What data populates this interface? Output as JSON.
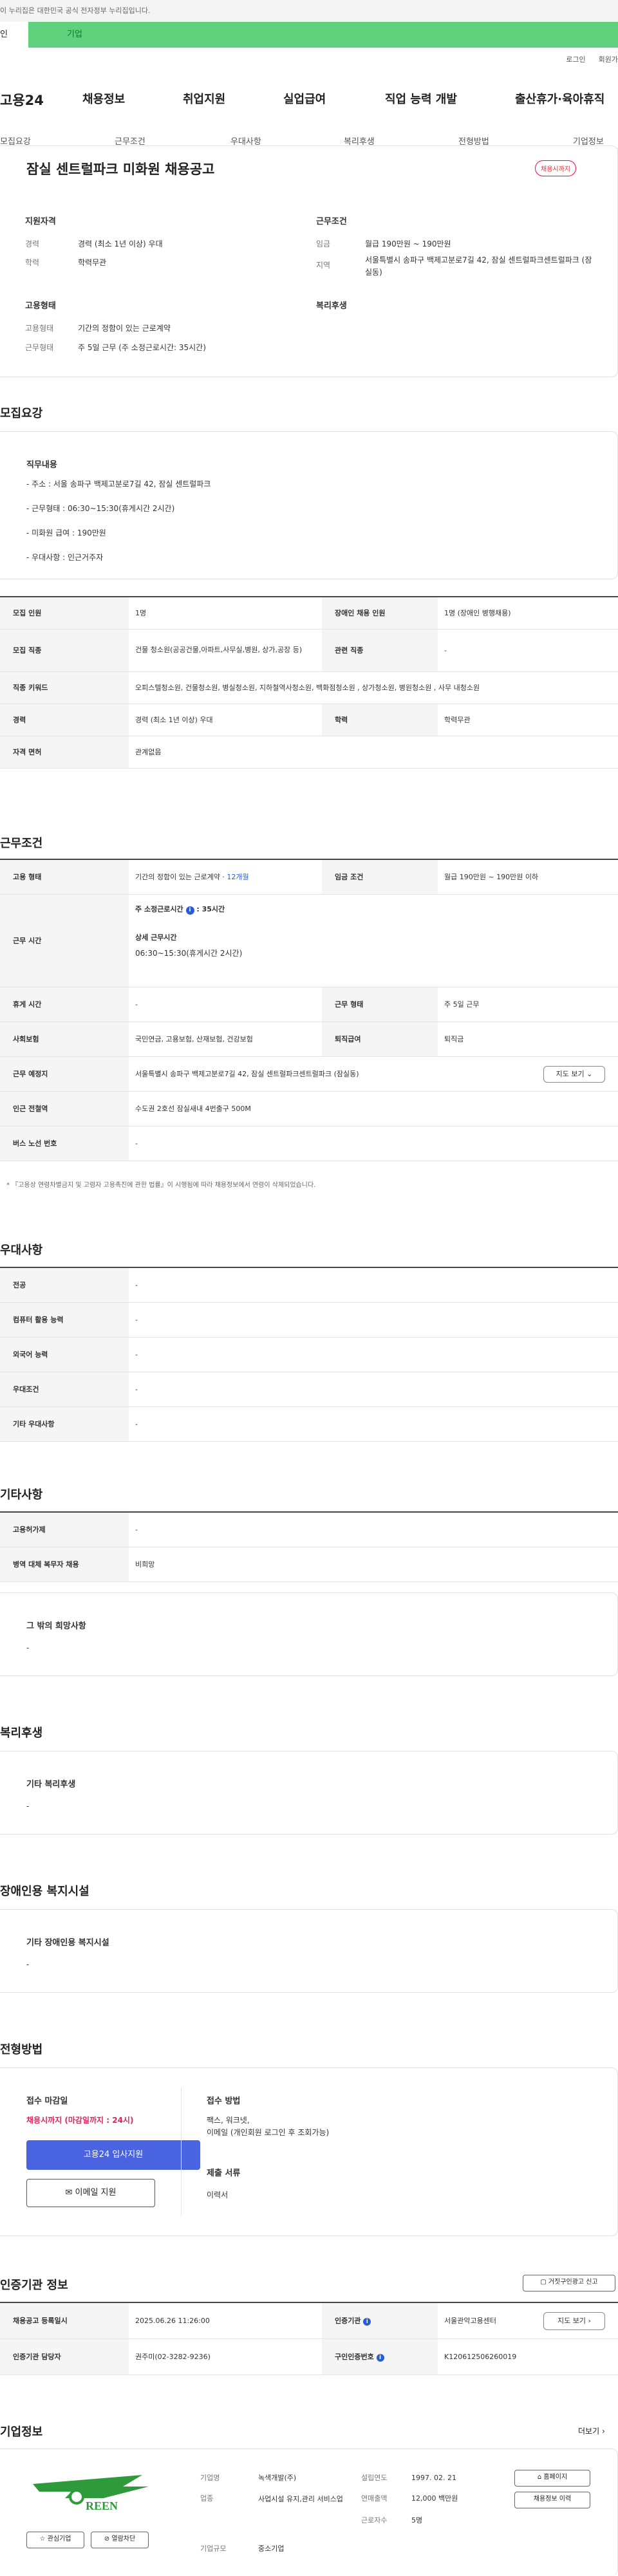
{
  "gov_bar": "이 누리집은 대한민국 공식 전자정부 누리집입니다.",
  "tabs": [
    "인",
    "기업"
  ],
  "util": [
    "로그인",
    "회원가"
  ],
  "brand": "고용24",
  "gnb": [
    "채용정보",
    "취업지원",
    "실업급여",
    "직업 능력 개발",
    "출산휴가·육아휴직"
  ],
  "snb": [
    "모집요강",
    "근무조건",
    "우대사항",
    "복리후생",
    "전형방법",
    "기업정보"
  ],
  "summary": {
    "title": "잠실 센트럴파크 미화원 채용공고",
    "badge": "채용시까지",
    "qual_head": "지원자격",
    "cond_head": "근무조건",
    "exp_label": "경력",
    "exp_value": "경력 (최소 1년 이상) 우대",
    "edu_label": "학력",
    "edu_value": "학력무관",
    "pay_label": "임금",
    "pay_value": "월급 190만원 ~ 190만원",
    "area_label": "지역",
    "area_value": "서울특별시 송파구 백제고분로7길 42, 잠실 센트럴파크센트럴파크 (잠실동)",
    "emp_head": "고용형태",
    "welfare_head": "복리후생",
    "emptype_label": "고용형태",
    "emptype_value": "기간의 정함이 있는 근로계약",
    "worktype_label": "근무형태",
    "worktype_value": "주 5일 근무 (주 소정근로시간: 35시간)"
  },
  "recruit": {
    "head": "모집요강",
    "duty_head": "직무내용",
    "duties": [
      "- 주소 : 서울 송파구 백제고분로7길 42, 잠실 센트럴파크",
      "- 근무형태 : 06:30~15:30(휴게시간 2시간)",
      "- 미화원 급여 : 190만원",
      "- 우대사항 : 인근거주자"
    ],
    "rows": {
      "count_l": "모집 인원",
      "count_v": "1명",
      "dis_l": "장애인 채용 인원",
      "dis_v": "1명 (장애인 병행채용)",
      "job_l": "모집 직종",
      "job_v": "건물 청소원(공공건물,아파트,사무실,병원, 상가,공장 등)",
      "rel_l": "관련 직종",
      "rel_v": "-",
      "kw_l": "직종 키워드",
      "kw_v": "오피스텔청소원, 건물청소원, 병실청소원, 지하철역사청소원, 백화점청소원 , 상가청소원, 병원청소원 , 사무 내청소원",
      "car_l": "경력",
      "car_v": "경력 (최소 1년 이상) 우대",
      "edu_l": "학력",
      "edu_v": "학력무관",
      "lic_l": "자격 면허",
      "lic_v": "관계없음"
    }
  },
  "work": {
    "head": "근무조건",
    "emp_l": "고용 형태",
    "emp_v": "기간의 정함이 있는 근로계약 · ",
    "emp_months": "12개월",
    "pay_l": "임금 조건",
    "pay_v": "월급 190만원 ~ 190만원 이하",
    "time_l": "근무 시간",
    "weekly_l": "주 소정근로시간",
    "weekly_v": ": 35시간",
    "detail_l": "상세 근무시간",
    "detail_v": "06:30~15:30(휴게시간 2시간)",
    "rest_l": "휴게 시간",
    "rest_v": "-",
    "form_l": "근무 형태",
    "form_v": "주 5일 근무",
    "ins_l": "사회보험",
    "ins_v": "국민연금, 고용보험, 산재보험, 건강보험",
    "ret_l": "퇴직급여",
    "ret_v": "퇴직금",
    "loc_l": "근무 예정지",
    "loc_v": "서울특별시 송파구 백제고분로7길 42, 잠실 센트럴파크센트럴파크 (잠실동)",
    "map_btn": "지도 보기",
    "sub_l": "인근 전철역",
    "sub_v": "수도권 2호선 잠실새내 4번출구 500M",
    "bus_l": "버스 노선 번호",
    "bus_v": "-",
    "note": "* 『고용상 연령차별금지 및 고령자 고용촉진에 관한 법률』이 시행됨에 따라 채용정보에서 연령이 삭제되었습니다."
  },
  "pref": {
    "head": "우대사항",
    "rows": [
      [
        "전공",
        "-"
      ],
      [
        "컴퓨터 활용 능력",
        "-"
      ],
      [
        "외국어 능력",
        "-"
      ],
      [
        "우대조건",
        "-"
      ],
      [
        "기타 우대사항",
        "-"
      ]
    ]
  },
  "etc": {
    "head": "기타사항",
    "rows": [
      [
        "고용허가제",
        "-"
      ],
      [
        "병역 대체 복무자 채용",
        "비희망"
      ]
    ],
    "box_head": "그 밖의 희망사항",
    "box_val": "-"
  },
  "welfare": {
    "head": "복리후생",
    "box_head": "기타 복리후생",
    "box_val": "-"
  },
  "disability": {
    "head": "장애인용 복지시설",
    "box_head": "기타 장애인용 복지시설",
    "box_val": "-"
  },
  "apply": {
    "head": "전형방법",
    "deadline_l": "접수 마감일",
    "deadline_v": "채용시까지 (마감일까지 : 24시)",
    "apply_btn": "고용24 입사지원",
    "email_btn": "이메일 지원",
    "method_l": "접수 방법",
    "method_v": "팩스, 워크넷,\n이메일 (개인회원 로그인 후 조회가능)",
    "docs_l": "제출 서류",
    "docs_v": "이력서"
  },
  "cert": {
    "head": "인증기관 정보",
    "report_btn": "거짓구인광고 신고",
    "reg_l": "채용공고 등록일시",
    "reg_v": "2025.06.26 11:26:00",
    "org_l": "인증기관",
    "org_v": "서울관악고용센터",
    "map_btn": "지도 보기",
    "mgr_l": "인증기관 담당자",
    "mgr_v": "권주미(02-3282-9236)",
    "num_l": "구인인증번호",
    "num_v": "K120612506260019"
  },
  "company": {
    "head": "기업정보",
    "more": "더보기",
    "logo_text": "REEN",
    "fav_btn": "관심기업",
    "block_btn": "열람차단",
    "name_l": "기업명",
    "name_v": "녹색개발(주)",
    "year_l": "설립연도",
    "year_v": "1997. 02. 21",
    "biz_l": "업종",
    "biz_v": "사업시설 유지,관리 서비스업",
    "sales_l": "연매출액",
    "sales_v": "12,000 백만원",
    "emp_l": "근로자수",
    "emp_v": "5명",
    "size_l": "기업규모",
    "size_v": "중소기업",
    "home_btn": "홈페이지",
    "jobs_btn": "채용정보 이력",
    "green": "#2e9a3c"
  }
}
